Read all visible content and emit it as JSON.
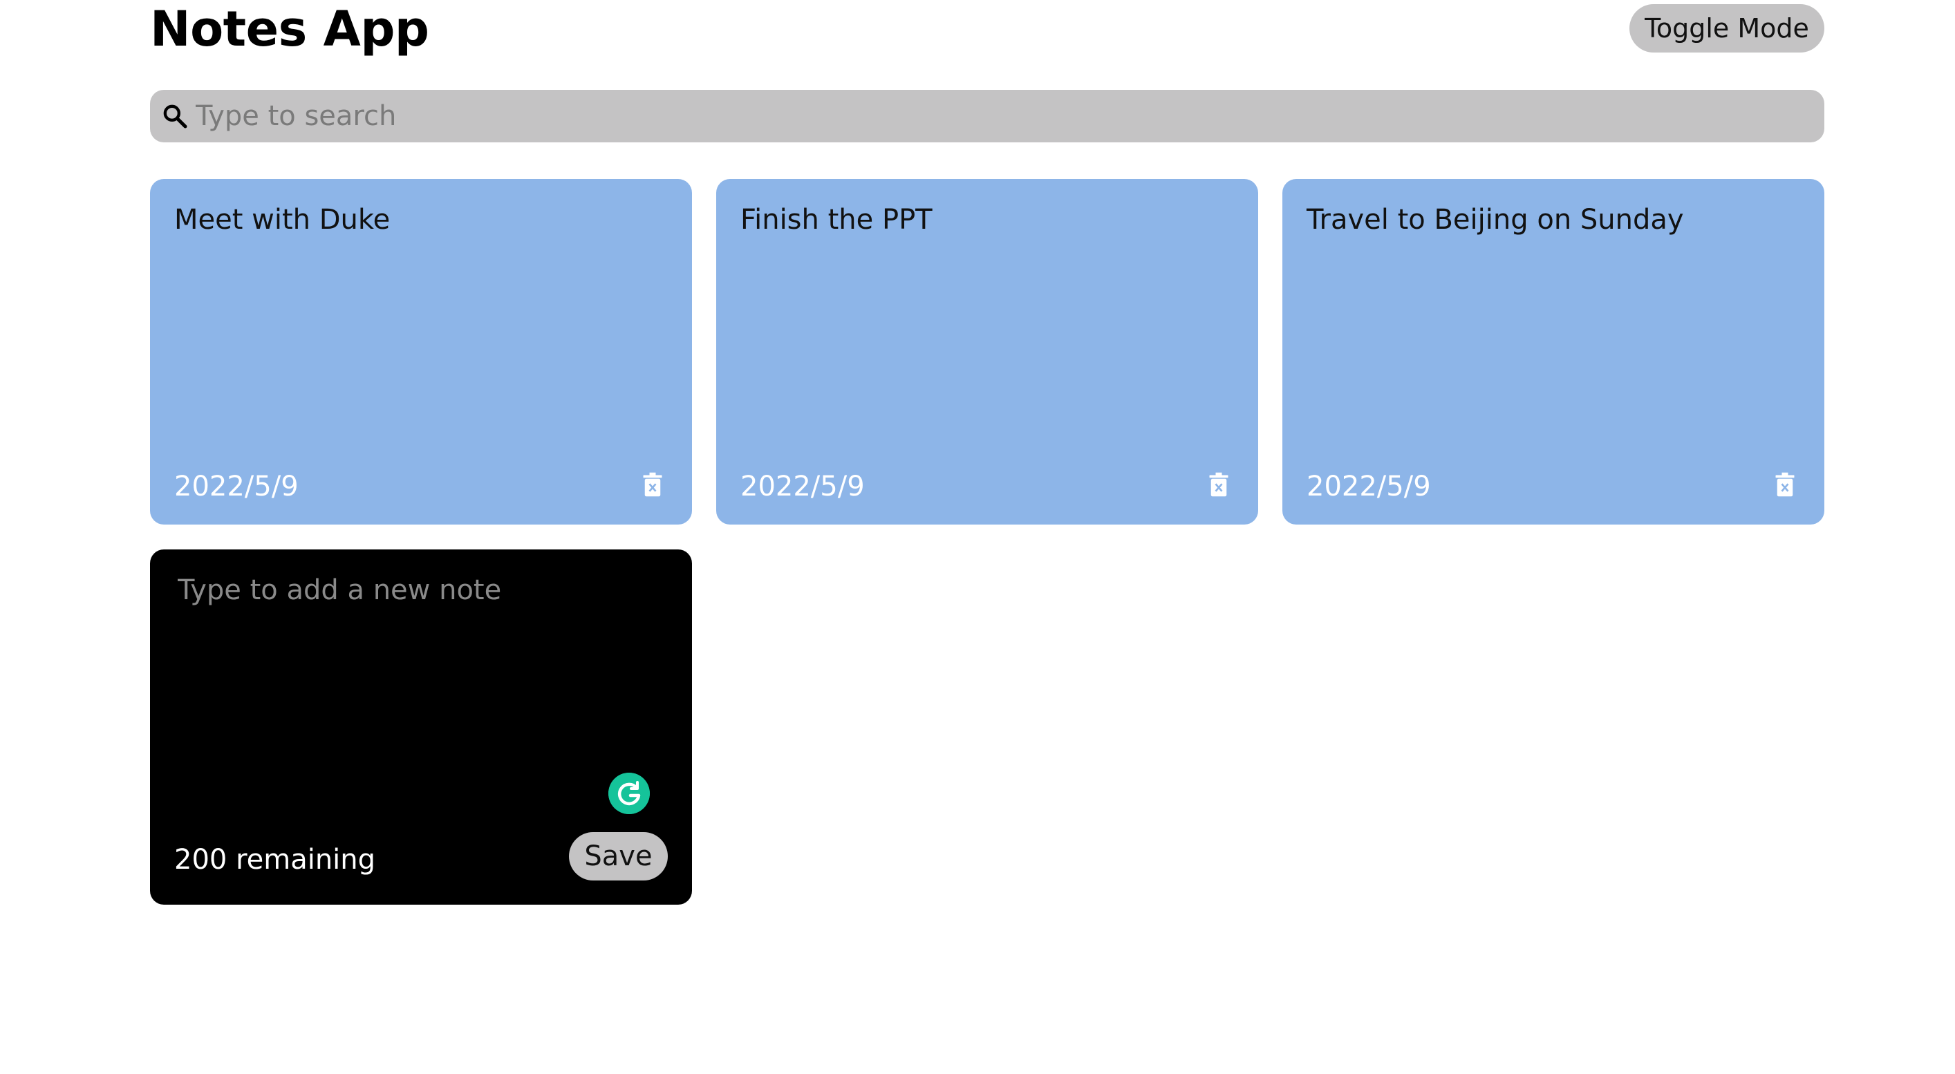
{
  "app": {
    "title": "Notes App",
    "toggle_mode_label": "Toggle Mode"
  },
  "search": {
    "placeholder": "Type to search",
    "value": "",
    "icon": "search-icon"
  },
  "notes": [
    {
      "text": "Meet with Duke",
      "date": "2022/5/9",
      "delete_icon": "trash-icon"
    },
    {
      "text": "Finish the PPT",
      "date": "2022/5/9",
      "delete_icon": "trash-icon"
    },
    {
      "text": "Travel to Beijing on Sunday",
      "date": "2022/5/9",
      "delete_icon": "trash-icon"
    }
  ],
  "new_note": {
    "placeholder": "Type to add a new note",
    "value": "",
    "remaining_text": "200 remaining",
    "save_label": "Save",
    "assistant_icon": "grammarly-icon"
  },
  "colors": {
    "note_background": "#8db5e8",
    "new_note_background": "#000000",
    "button_background": "#c4c3c4",
    "search_background": "#c4c3c4",
    "date_text": "#ffffff",
    "grammarly_green": "#15c39a"
  }
}
